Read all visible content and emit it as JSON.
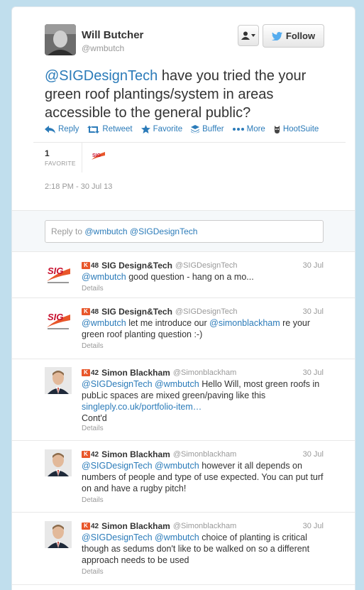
{
  "tweet": {
    "author_name": "Will Butcher",
    "author_handle": "@wmbutch",
    "follow_label": "Follow",
    "text_mention": "@SIGDesignTech",
    "text_body": " have you tried the your green roof plantings/system in areas accessible to the general public?",
    "actions": {
      "reply": "Reply",
      "retweet": "Retweet",
      "favorite": "Favorite",
      "buffer": "Buffer",
      "more": "More",
      "hootsuite": "HootSuite"
    },
    "favorite_count": "1",
    "favorite_label": "FAVORITE",
    "timestamp": "2:18 PM - 30 Jul 13"
  },
  "reply_box": {
    "prefix": "Reply to ",
    "mentions": "@wmbutch @SIGDesignTech"
  },
  "replies": [
    {
      "klout": "48",
      "name": "SIG Design&Tech",
      "handle": "@SIGDesignTech",
      "date": "30 Jul",
      "mention": "@wmbutch",
      "text": " good question - hang on a mo...",
      "details": "Details"
    },
    {
      "klout": "48",
      "name": "SIG Design&Tech",
      "handle": "@SIGDesignTech",
      "date": "30 Jul",
      "mention": "@wmbutch",
      "text": " let me introduce our ",
      "mention2": "@simonblackham",
      "text2": " re your green roof planting question :-)",
      "details": "Details"
    },
    {
      "klout": "42",
      "name": "Simon Blackham",
      "handle": "@Simonblackham",
      "date": "30 Jul",
      "mention": "@SIGDesignTech @wmbutch",
      "text": " Hello Will, most green roofs in pubLic spaces are mixed green/paving like this",
      "link": "singleply.co.uk/portfolio-item…",
      "text2": "Cont'd",
      "details": "Details"
    },
    {
      "klout": "42",
      "name": "Simon Blackham",
      "handle": "@Simonblackham",
      "date": "30 Jul",
      "mention": "@SIGDesignTech @wmbutch",
      "text": " however it all depends on numbers of people and type of use expected. You can put turf on and have a rugby pitch!",
      "details": "Details"
    },
    {
      "klout": "42",
      "name": "Simon Blackham",
      "handle": "@Simonblackham",
      "date": "30 Jul",
      "mention": "@SIGDesignTech @wmbutch",
      "text": " choice of planting is critical though as sedums don't like to be walked on so a different approach needs to be used",
      "details": "Details"
    }
  ],
  "colors": {
    "background": "#c0deed",
    "link": "#2b7bb9",
    "klout": "#e8562a"
  }
}
